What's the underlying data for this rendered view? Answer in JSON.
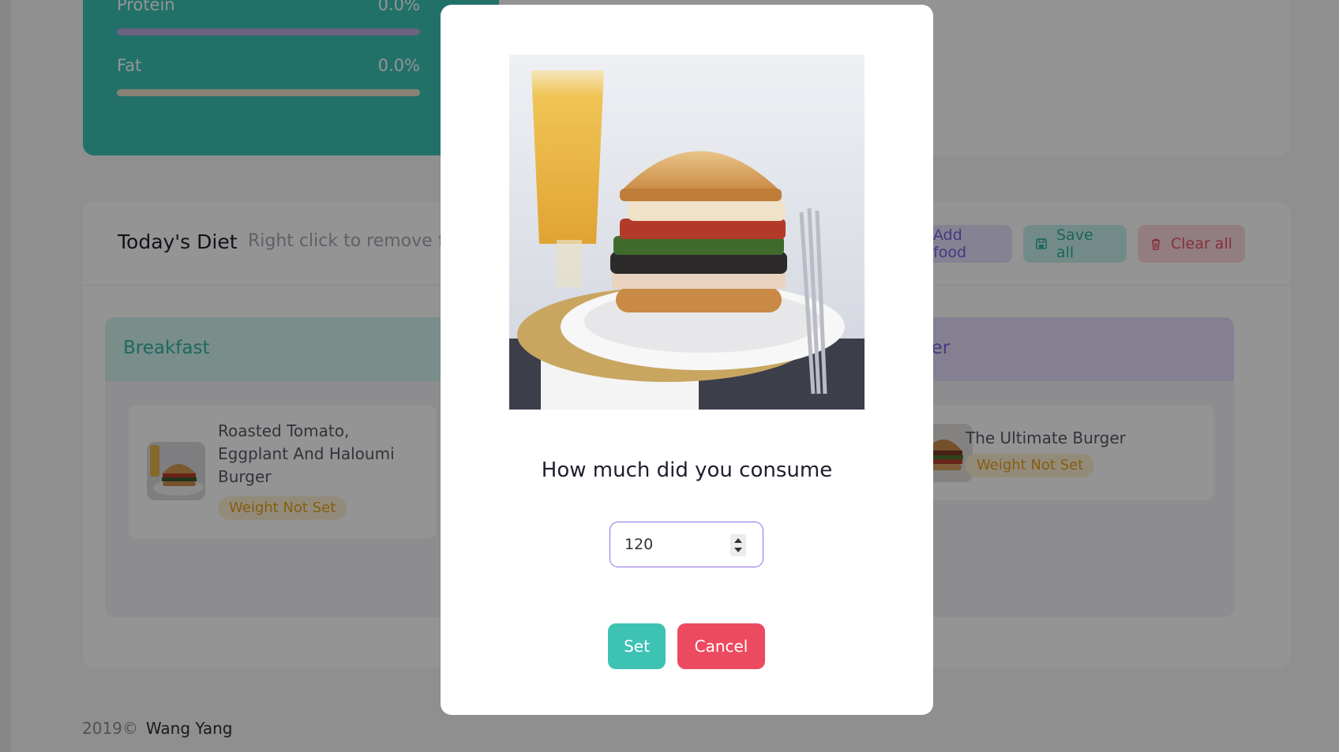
{
  "macros": [
    {
      "name": "Protein",
      "value": "0.0%",
      "percent": 0,
      "track_color": "#b8aadf"
    },
    {
      "name": "Fat",
      "value": "0.0%",
      "percent": 0,
      "track_color": "#e8e2c6"
    }
  ],
  "diet": {
    "title": "Today's Diet",
    "hint": "Right click to remove fo",
    "buttons": {
      "add": "Add food",
      "save": "Save all",
      "clear": "Clear all"
    },
    "meals": {
      "breakfast": {
        "title": "Breakfast",
        "items": [
          {
            "name": "Roasted Tomato,\nEggplant And Haloumi\nBurger",
            "badge": "Weight Not Set"
          }
        ]
      },
      "dinner": {
        "title": "ner",
        "items": [
          {
            "name": "The Ultimate Burger",
            "badge": "Weight Not Set"
          }
        ]
      }
    }
  },
  "footer": {
    "copyright": "2019©",
    "author": "Wang Yang"
  },
  "modal": {
    "question": "How much did you consume",
    "quantity_value": "120",
    "set_label": "Set",
    "cancel_label": "Cancel",
    "image_icon": "burger-photo"
  },
  "colors": {
    "accent_teal": "#3ec2b4",
    "accent_red": "#ec4a60",
    "accent_purple": "#8f6bea",
    "badge_orange": "#e4a21b"
  }
}
